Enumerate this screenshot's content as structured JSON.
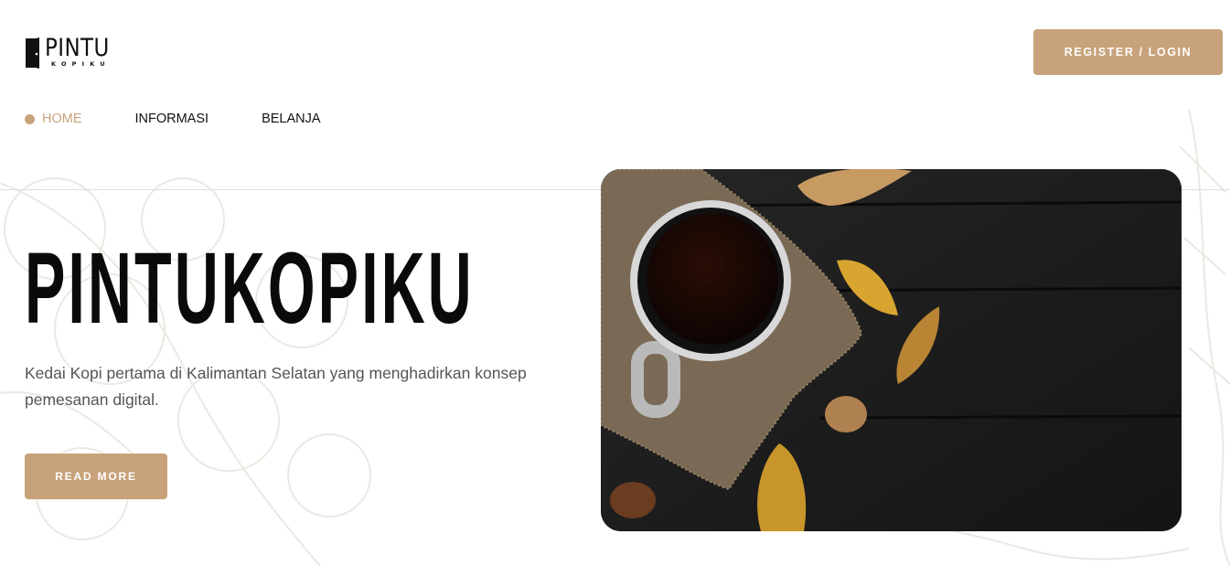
{
  "logo": {
    "title": "PINTU",
    "subtitle": "KOPIKU",
    "icon": "door-icon"
  },
  "header": {
    "auth_label": "REGISTER / LOGIN"
  },
  "nav": {
    "items": [
      {
        "label": "HOME",
        "active": true
      },
      {
        "label": "INFORMASI",
        "active": false
      },
      {
        "label": "BELANJA",
        "active": false
      }
    ]
  },
  "hero": {
    "title": "PINTUKOPIKU",
    "description": "Kedai Kopi pertama di Kalimantan Selatan yang menghadirkan konsep pemesanan digital.",
    "cta_label": "READ MORE",
    "image": "coffee-cup-on-dark-table-with-autumn-leaves"
  },
  "colors": {
    "accent": "#c8a27a",
    "text": "#111111",
    "muted": "#555555",
    "divider": "#dddddd"
  }
}
